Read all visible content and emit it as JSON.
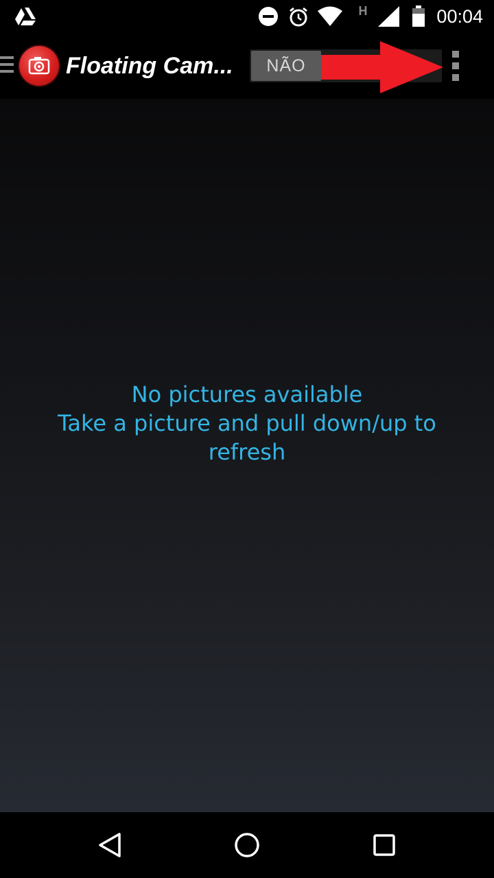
{
  "status_bar": {
    "time": "00:04",
    "network_type": "H",
    "icons": [
      "google-drive-icon",
      "do-not-disturb-icon",
      "alarm-icon",
      "wifi-icon",
      "cell-signal-icon",
      "battery-icon"
    ]
  },
  "action_bar": {
    "title": "Floating Cam...",
    "toggle_label": "NÃO",
    "icons": [
      "drawer-icon",
      "app-logo-icon",
      "overflow-menu-icon"
    ],
    "annotation_arrow_color": "#ee1c25"
  },
  "content": {
    "line1": "No pictures available",
    "line2": "Take a picture and pull down/up to refresh",
    "text_color": "#33b5e5"
  },
  "nav_bar": {
    "icons": [
      "back-icon",
      "home-icon",
      "recents-icon"
    ]
  }
}
